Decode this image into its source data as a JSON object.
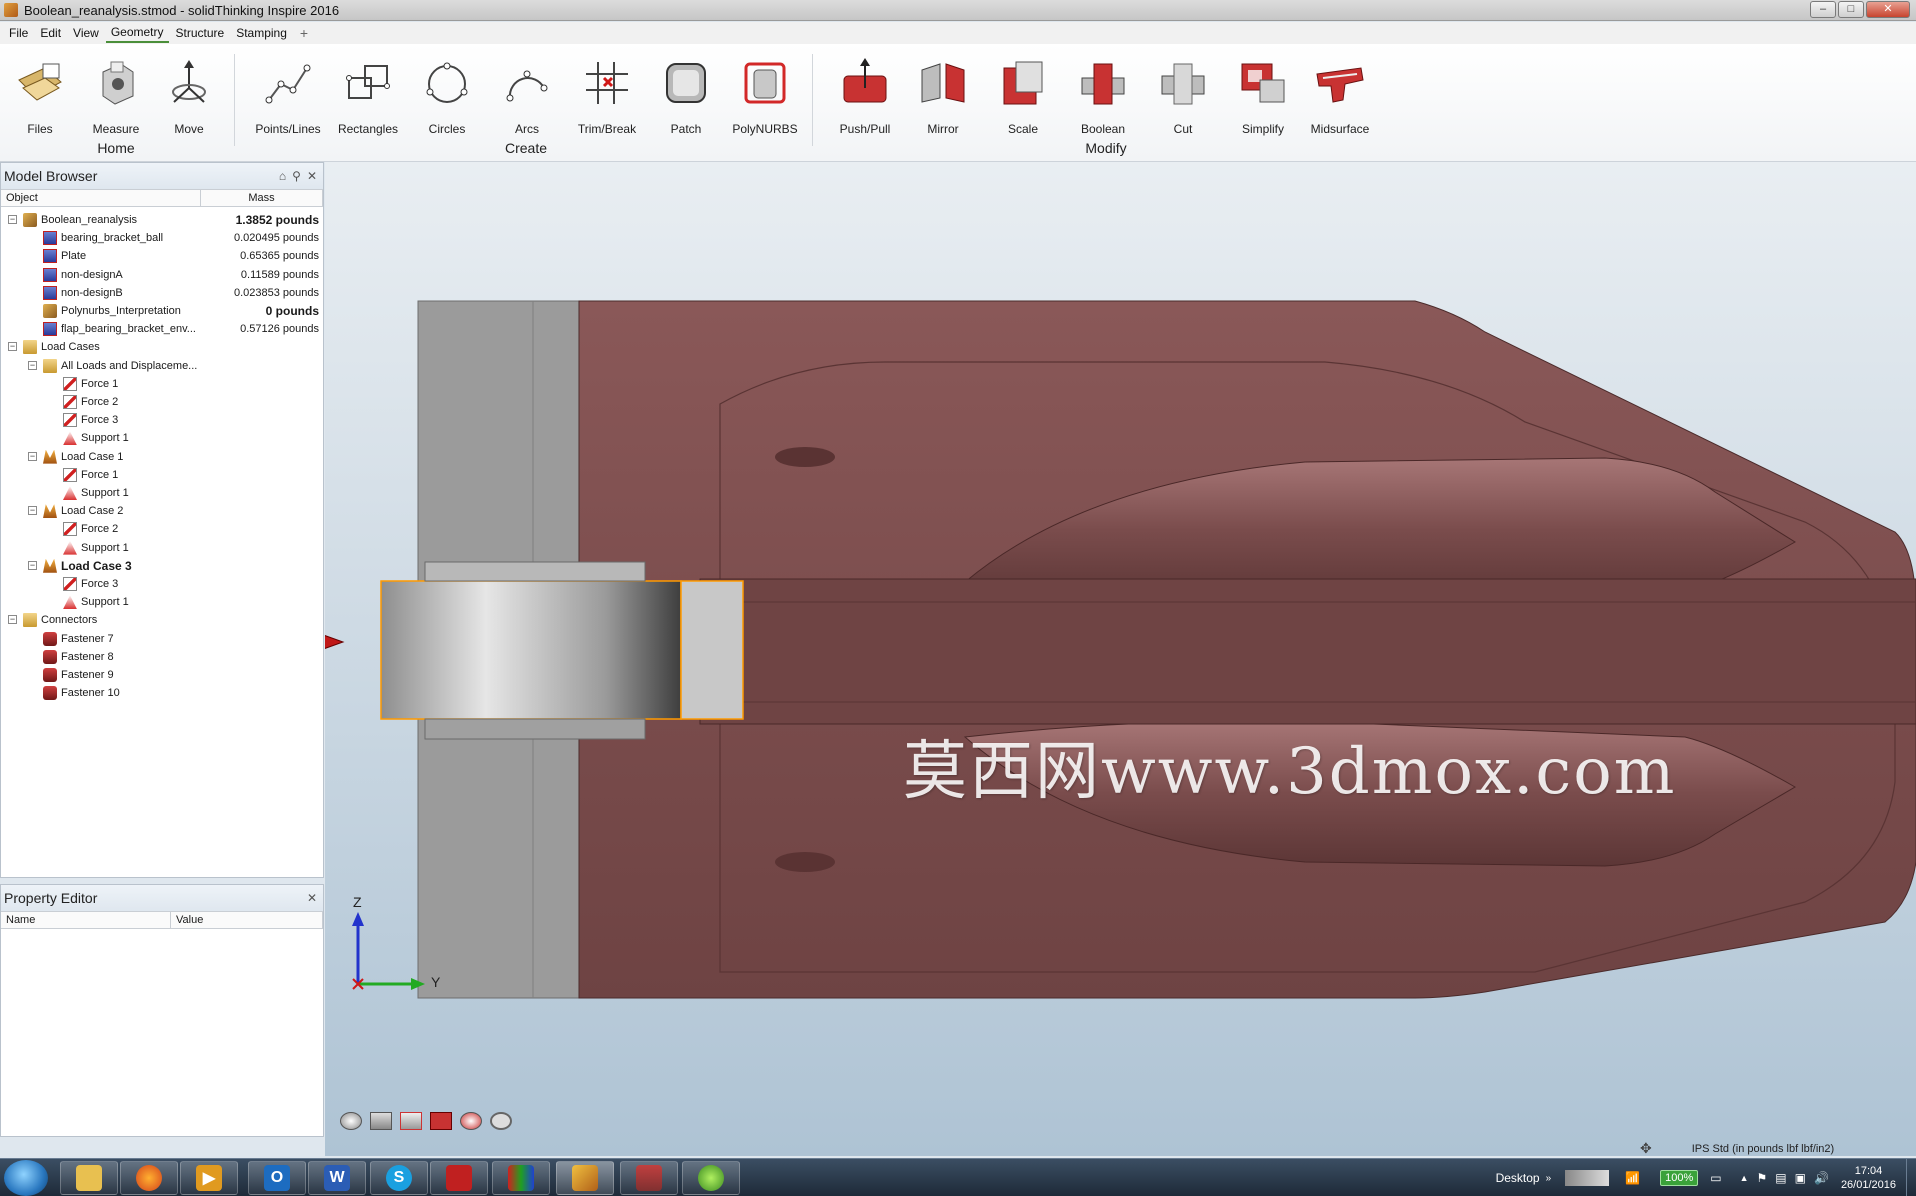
{
  "window": {
    "title": "Boolean_reanalysis.stmod - solidThinking Inspire 2016",
    "minimize": "–",
    "maximize": "□",
    "close": "✕"
  },
  "menu": {
    "items": [
      "File",
      "Edit",
      "View",
      "Geometry",
      "Structure",
      "Stamping"
    ],
    "active": "Geometry",
    "plus": "+"
  },
  "ribbon": {
    "groups": [
      {
        "label": "Home",
        "buttons": [
          "Files",
          "Measure",
          "Move"
        ]
      },
      {
        "label": "Create",
        "buttons": [
          "Points/Lines",
          "Rectangles",
          "Circles",
          "Arcs",
          "Trim/Break",
          "Patch",
          "PolyNURBS"
        ]
      },
      {
        "label": "Modify",
        "buttons": [
          "Push/Pull",
          "Mirror",
          "Scale",
          "Boolean",
          "Cut",
          "Simplify",
          "Midsurface"
        ]
      }
    ]
  },
  "model_browser": {
    "title": "Model Browser",
    "columns": [
      "Object",
      "Mass"
    ],
    "rows": [
      {
        "label": "Boolean_reanalysis",
        "mass": "1.3852 pounds",
        "bold_mass": true
      },
      {
        "label": "bearing_bracket_ball",
        "mass": "0.020495 pounds"
      },
      {
        "label": "Plate",
        "mass": "0.65365 pounds"
      },
      {
        "label": "non-designA",
        "mass": "0.11589 pounds"
      },
      {
        "label": "non-designB",
        "mass": "0.023853 pounds"
      },
      {
        "label": "Polynurbs_Interpretation",
        "mass": "0 pounds",
        "bold_mass": true
      },
      {
        "label": "flap_bearing_bracket_env...",
        "mass": "0.57126 pounds"
      },
      {
        "label": "Load Cases",
        "mass": ""
      },
      {
        "label": "All Loads and Displaceme...",
        "mass": ""
      },
      {
        "label": "Force 1",
        "mass": ""
      },
      {
        "label": "Force 2",
        "mass": ""
      },
      {
        "label": "Force 3",
        "mass": ""
      },
      {
        "label": "Support 1",
        "mass": ""
      },
      {
        "label": "Load Case 1",
        "mass": ""
      },
      {
        "label": "Force 1",
        "mass": ""
      },
      {
        "label": "Support 1",
        "mass": ""
      },
      {
        "label": "Load Case 2",
        "mass": ""
      },
      {
        "label": "Force 2",
        "mass": ""
      },
      {
        "label": "Support 1",
        "mass": ""
      },
      {
        "label": "Load Case 3",
        "mass": "",
        "bold": true
      },
      {
        "label": "Force 3",
        "mass": ""
      },
      {
        "label": "Support 1",
        "mass": ""
      },
      {
        "label": "Connectors",
        "mass": ""
      },
      {
        "label": "Fastener 7",
        "mass": ""
      },
      {
        "label": "Fastener 8",
        "mass": ""
      },
      {
        "label": "Fastener 9",
        "mass": ""
      },
      {
        "label": "Fastener 10",
        "mass": ""
      }
    ]
  },
  "property_editor": {
    "title": "Property Editor",
    "columns": [
      "Name",
      "Value"
    ]
  },
  "viewport": {
    "watermark": "莫西网www.3dmox.com",
    "axis_z": "Z",
    "axis_y": "Y"
  },
  "status": {
    "units": "IPS Std (in pounds lbf lbf/in2)"
  },
  "taskbar": {
    "desktop": "Desktop",
    "battery": "100%",
    "time": "17:04",
    "date": "26/01/2016",
    "apps": [
      "explorer",
      "firefox",
      "media-player",
      "outlook",
      "word",
      "skype",
      "app-red",
      "app-rubik",
      "inspire",
      "app-3d",
      "app-green"
    ]
  },
  "colors": {
    "part": "#7e5050",
    "accent": "#4b8f3a",
    "plate": "#9b9b9b"
  }
}
